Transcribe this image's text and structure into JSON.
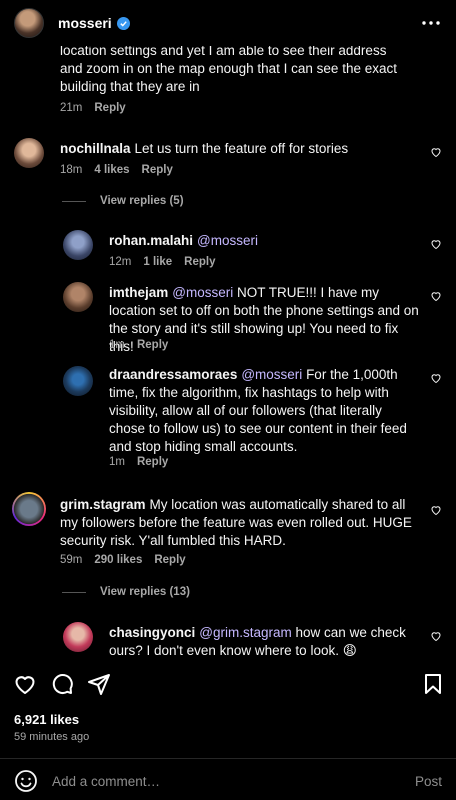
{
  "header": {
    "username": "mosseri"
  },
  "comments": {
    "c0": {
      "text": "location settings and yet I am able to see their address and zoom in on the map enough that I can see the exact building that they are in",
      "time": "21m",
      "reply": "Reply"
    },
    "c1": {
      "user": "nochillnala",
      "text": "Let us turn the feature off for stories",
      "time": "18m",
      "likes": "4 likes",
      "reply": "Reply",
      "view_replies": "View replies (5)"
    },
    "r1": {
      "user": "rohan.malahi",
      "mention": "@mosseri",
      "text": "",
      "time": "12m",
      "likes": "1 like",
      "reply": "Reply"
    },
    "r2": {
      "user": "imthejam",
      "mention": "@mosseri",
      "text": "NOT TRUE!!! I have my location set to off on both the phone settings and on the story and it's still showing up! You need to fix this!",
      "time": "1m",
      "reply": "Reply"
    },
    "r3": {
      "user": "draandressamoraes",
      "mention": "@mosseri",
      "text": "For the 1,000th time, fix the algorithm, fix hashtags to help with visibility, allow all of our followers (that literally chose to follow us) to see our content in their feed and stop hiding small accounts.",
      "time": "1m",
      "reply": "Reply"
    },
    "c2": {
      "user": "grim.stagram",
      "text": "My location was automatically shared to all my followers before the feature was even rolled out. HUGE security risk. Y'all fumbled this HARD.",
      "time": "59m",
      "likes": "290 likes",
      "reply": "Reply",
      "view_replies": "View replies (13)"
    },
    "r4": {
      "user": "chasingyonci",
      "mention": "@grim.stagram",
      "text": "how can we check ours? I don't even know where to look. 😩"
    }
  },
  "post": {
    "likes": "6,921 likes",
    "time_ago": "59 minutes ago"
  },
  "composer": {
    "placeholder": "Add a comment…",
    "post_label": "Post"
  },
  "colors": {
    "background": "#000000",
    "mention": "#c5b8ff",
    "verified": "#3797f0",
    "secondary_text": "#a8a8a8"
  },
  "icons": [
    "more-icon",
    "heart-icon",
    "comment-icon",
    "share-icon",
    "bookmark-icon",
    "emoji-icon",
    "verified-icon"
  ]
}
